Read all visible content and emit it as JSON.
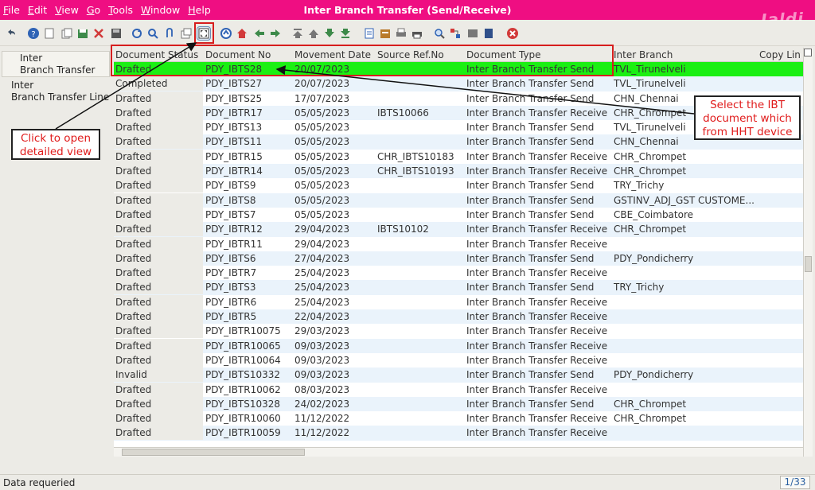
{
  "menu": [
    "File",
    "Edit",
    "View",
    "Go",
    "Tools",
    "Window",
    "Help"
  ],
  "window_title": "Inter Branch Transfer (Send/Receive)",
  "logo_text": "Jaldi",
  "nav": {
    "items": [
      {
        "line1": "Inter",
        "line2": "Branch Transfer"
      },
      {
        "line1": "Inter",
        "line2": "Branch Transfer Line"
      }
    ]
  },
  "grid": {
    "columns": [
      "Document Status",
      "Document No",
      "Movement Date",
      "Source Ref.No",
      "Document Type",
      "Inter Branch",
      "Copy Lin"
    ],
    "rows": [
      [
        "Drafted",
        "PDY_IBTS28",
        "20/07/2023",
        "",
        "Inter Branch Transfer Send",
        "TVL_Tirunelveli",
        ""
      ],
      [
        "Completed",
        "PDY_IBTS27",
        "20/07/2023",
        "",
        "Inter Branch Transfer Send",
        "TVL_Tirunelveli",
        ""
      ],
      [
        "Drafted",
        "PDY_IBTS25",
        "17/07/2023",
        "",
        "Inter Branch Transfer Send",
        "CHN_Chennai",
        ""
      ],
      [
        "Drafted",
        "PDY_IBTR17",
        "05/05/2023",
        "IBTS10066",
        "Inter Branch Transfer Receive",
        "CHR_Chrompet",
        ""
      ],
      [
        "Drafted",
        "PDY_IBTS13",
        "05/05/2023",
        "",
        "Inter Branch Transfer Send",
        "TVL_Tirunelveli",
        ""
      ],
      [
        "Drafted",
        "PDY_IBTS11",
        "05/05/2023",
        "",
        "Inter Branch Transfer Send",
        "CHN_Chennai",
        ""
      ],
      [
        "Drafted",
        "PDY_IBTR15",
        "05/05/2023",
        "CHR_IBTS10183",
        "Inter Branch Transfer Receive",
        "CHR_Chrompet",
        ""
      ],
      [
        "Drafted",
        "PDY_IBTR14",
        "05/05/2023",
        "CHR_IBTS10193",
        "Inter Branch Transfer Receive",
        "CHR_Chrompet",
        ""
      ],
      [
        "Drafted",
        "PDY_IBTS9",
        "05/05/2023",
        "",
        "Inter Branch Transfer Send",
        "TRY_Trichy",
        ""
      ],
      [
        "Drafted",
        "PDY_IBTS8",
        "05/05/2023",
        "",
        "Inter Branch Transfer Send",
        "GSTINV_ADJ_GST CUSTOME...",
        ""
      ],
      [
        "Drafted",
        "PDY_IBTS7",
        "05/05/2023",
        "",
        "Inter Branch Transfer Send",
        "CBE_Coimbatore",
        ""
      ],
      [
        "Drafted",
        "PDY_IBTR12",
        "29/04/2023",
        "IBTS10102",
        "Inter Branch Transfer Receive",
        "CHR_Chrompet",
        ""
      ],
      [
        "Drafted",
        "PDY_IBTR11",
        "29/04/2023",
        "",
        "Inter Branch Transfer Receive",
        "",
        ""
      ],
      [
        "Drafted",
        "PDY_IBTS6",
        "27/04/2023",
        "",
        "Inter Branch Transfer Send",
        "PDY_Pondicherry",
        ""
      ],
      [
        "Drafted",
        "PDY_IBTR7",
        "25/04/2023",
        "",
        "Inter Branch Transfer Receive",
        "",
        ""
      ],
      [
        "Drafted",
        "PDY_IBTS3",
        "25/04/2023",
        "",
        "Inter Branch Transfer Send",
        "TRY_Trichy",
        ""
      ],
      [
        "Drafted",
        "PDY_IBTR6",
        "25/04/2023",
        "",
        "Inter Branch Transfer Receive",
        "",
        ""
      ],
      [
        "Drafted",
        "PDY_IBTR5",
        "22/04/2023",
        "",
        "Inter Branch Transfer Receive",
        "",
        ""
      ],
      [
        "Drafted",
        "PDY_IBTR10075",
        "29/03/2023",
        "",
        "Inter Branch Transfer Receive",
        "",
        ""
      ],
      [
        "Drafted",
        "PDY_IBTR10065",
        "09/03/2023",
        "",
        "Inter Branch Transfer Receive",
        "",
        ""
      ],
      [
        "Drafted",
        "PDY_IBTR10064",
        "09/03/2023",
        "",
        "Inter Branch Transfer Receive",
        "",
        ""
      ],
      [
        "Invalid",
        "PDY_IBTS10332",
        "09/03/2023",
        "",
        "Inter Branch Transfer Send",
        "PDY_Pondicherry",
        ""
      ],
      [
        "Drafted",
        "PDY_IBTR10062",
        "08/03/2023",
        "",
        "Inter Branch Transfer Receive",
        "",
        ""
      ],
      [
        "Drafted",
        "PDY_IBTS10328",
        "24/02/2023",
        "",
        "Inter Branch Transfer Send",
        "CHR_Chrompet",
        ""
      ],
      [
        "Drafted",
        "PDY_IBTR10060",
        "11/12/2022",
        "",
        "Inter Branch Transfer Receive",
        "CHR_Chrompet",
        ""
      ],
      [
        "Drafted",
        "PDY_IBTR10059",
        "11/12/2022",
        "",
        "Inter Branch Transfer Receive",
        "",
        ""
      ]
    ],
    "selected_row": 0
  },
  "status": {
    "message": "Data requeried",
    "page": "1/33"
  },
  "annotations": {
    "open_view": "Click to open detailed view",
    "select_ibt": "Select the IBT document which from HHT device"
  },
  "colors": {
    "title_bar": "#ef0e82",
    "selected_row": "#1bef13",
    "annotation": "#e01b1b"
  }
}
